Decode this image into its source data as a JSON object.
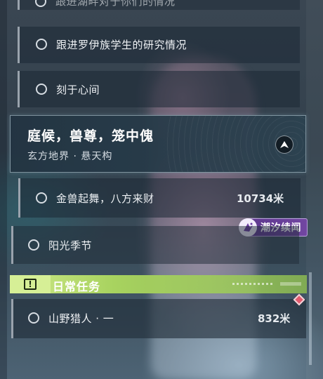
{
  "quests": {
    "partial_item": {
      "label": "跟进湖畔对于你们的情况"
    },
    "items": [
      {
        "label": "跟进罗伊族学生的研究情况"
      },
      {
        "label": "刻于心间"
      }
    ],
    "selected": {
      "title": "庭候，兽尊，笼中傀",
      "location": "玄方地界 · 悬天构"
    },
    "next": {
      "label": "金兽起舞，八方来财",
      "distance": "10734米"
    },
    "season": {
      "label": "阳光季节"
    }
  },
  "tag": {
    "label": "潮汐续闻",
    "color": "#7b46b0"
  },
  "daily": {
    "header": "日常任务",
    "icon": "exclamation-icon",
    "accent": "#b6dc6a",
    "items": [
      {
        "label": "山野猎人 · 一",
        "distance": "832米"
      }
    ]
  },
  "marker": {
    "icon": "diamond-marker-icon",
    "color": "#e25a6e"
  }
}
